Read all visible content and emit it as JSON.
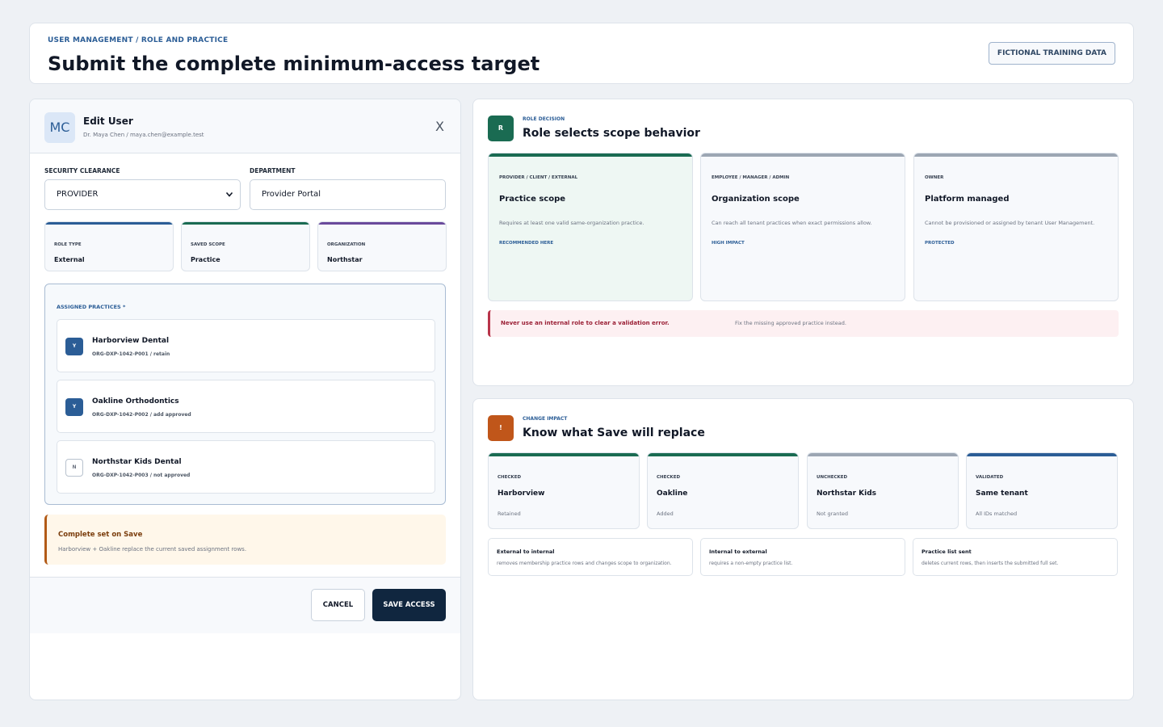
{
  "header": {
    "breadcrumb": "USER MANAGEMENT / ROLE AND PRACTICE",
    "title": "Submit the complete minimum-access target",
    "badge": "FICTIONAL TRAINING DATA"
  },
  "edit_user": {
    "avatar": "MC",
    "title": "Edit User",
    "subtitle": "Dr. Maya Chen / maya.chen@example.test",
    "close_label": "X",
    "security_clearance_label": "SECURITY CLEARANCE",
    "security_clearance_value": "PROVIDER",
    "department_label": "DEPARTMENT",
    "department_value": "Provider Portal",
    "summary": [
      {
        "key": "ROLE TYPE",
        "value": "External",
        "color": "#2b5d96"
      },
      {
        "key": "SAVED SCOPE",
        "value": "Practice",
        "color": "#1a6b52"
      },
      {
        "key": "ORGANIZATION",
        "value": "Northstar",
        "color": "#6a4a9c"
      }
    ],
    "assigned_practices_label": "ASSIGNED PRACTICES *",
    "practices": [
      {
        "check": "Y",
        "checked": true,
        "name": "Harborview Dental",
        "code": "ORG-DXP-1042-P001 / retain"
      },
      {
        "check": "Y",
        "checked": true,
        "name": "Oakline Orthodontics",
        "code": "ORG-DXP-1042-P002 / add approved"
      },
      {
        "check": "N",
        "checked": false,
        "name": "Northstar Kids Dental",
        "code": "ORG-DXP-1042-P003 / not approved"
      }
    ],
    "notice_title": "Complete set on Save",
    "notice_text": "Harborview + Oakline replace the current saved assignment rows.",
    "cancel_label": "CANCEL",
    "save_label": "SAVE ACCESS"
  },
  "role_decision": {
    "icon": "R",
    "tag": "ROLE DECISION",
    "title": "Role selects scope behavior",
    "cards": [
      {
        "key": "PROVIDER / CLIENT / EXTERNAL",
        "title": "Practice scope",
        "desc": "Requires at least one valid same-organization practice.",
        "note": "RECOMMENDED HERE",
        "bar": "#1a6b52",
        "bg": "#eef7f3"
      },
      {
        "key": "EMPLOYEE / MANAGER / ADMIN",
        "title": "Organization scope",
        "desc": "Can reach all tenant practices when exact permissions allow.",
        "note": "HIGH IMPACT",
        "bar": "#9ca6b3",
        "bg": "#f7f9fc"
      },
      {
        "key": "OWNER",
        "title": "Platform managed",
        "desc": "Cannot be provisioned or assigned by tenant User Management.",
        "note": "PROTECTED",
        "bar": "#9ca6b3",
        "bg": "#f7f9fc"
      }
    ],
    "alert_title": "Never use an internal role to clear a validation error.",
    "alert_text": "Fix the missing approved practice instead."
  },
  "change_impact": {
    "icon": "!",
    "tag": "CHANGE IMPACT",
    "title": "Know what Save will replace",
    "cards": [
      {
        "key": "CHECKED",
        "title": "Harborview",
        "desc": "Retained",
        "bar": "#1a6b52"
      },
      {
        "key": "CHECKED",
        "title": "Oakline",
        "desc": "Added",
        "bar": "#1a6b52"
      },
      {
        "key": "UNCHECKED",
        "title": "Northstar Kids",
        "desc": "Not granted",
        "bar": "#9ca6b3"
      },
      {
        "key": "VALIDATED",
        "title": "Same tenant",
        "desc": "All IDs matched",
        "bar": "#2b5d96"
      }
    ],
    "notes": [
      {
        "title": "External to internal",
        "desc": "removes membership practice rows and changes scope to organization."
      },
      {
        "title": "Internal to external",
        "desc": "requires a non-empty practice list."
      },
      {
        "title": "Practice list sent",
        "desc": "deletes current rows, then inserts the submitted full set."
      }
    ]
  },
  "colors": {
    "accent": "#2b5d96",
    "primary_button": "#10263f",
    "role_icon": "#1a6b52",
    "impact_icon": "#c0561a",
    "warning": "#b25a16",
    "danger": "#b8344a"
  }
}
